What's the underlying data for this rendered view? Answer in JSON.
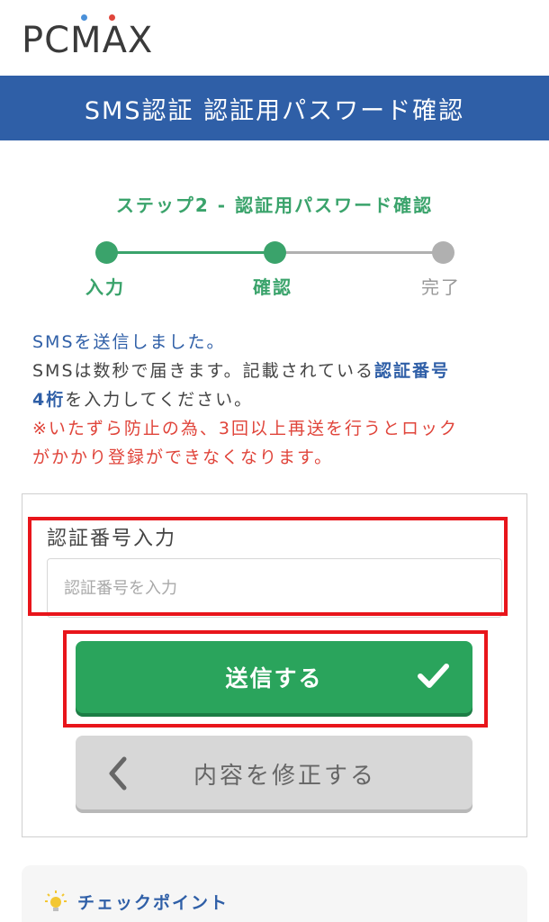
{
  "header": {
    "logo_text": "PCMAX",
    "logo_dots": [
      "#4a90d9",
      "#e0453b"
    ]
  },
  "titlebar": {
    "title": "SMS認証 認証用パスワード確認"
  },
  "stepper": {
    "title": "ステップ2 - 認証用パスワード確認",
    "steps": [
      {
        "label": "入力",
        "state": "done"
      },
      {
        "label": "確認",
        "state": "current"
      },
      {
        "label": "完了",
        "state": "pending"
      }
    ]
  },
  "info": {
    "line1": "SMSを送信しました。",
    "line2_prefix": "SMSは数秒で届きます。記載されている",
    "line2_highlight": "認証番号",
    "line3_highlight": "4桁",
    "line3_suffix": "を入力してください。",
    "warning_line1": "※いたずら防止の為、3回以上再送を行うとロック",
    "warning_line2": "がかかり登録ができなくなります。"
  },
  "form": {
    "field_label": "認証番号入力",
    "input_placeholder": "認証番号を入力",
    "input_value": "",
    "submit_label": "送信する",
    "back_label": "内容を修正する"
  },
  "checkpoint": {
    "label": "チェックポイント"
  },
  "colors": {
    "brand_blue": "#2f5fa7",
    "step_green": "#3aa36b",
    "button_green": "#2aa45c",
    "warning_red": "#e0453b",
    "highlight_red": "#e8151b"
  }
}
